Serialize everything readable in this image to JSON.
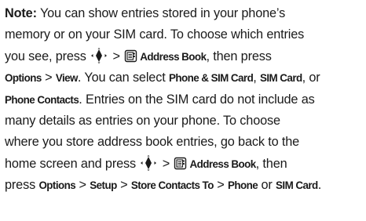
{
  "note": {
    "label": "Note:",
    "line1": " You can show entries stored in your phone’s",
    "line2": "memory or on your SIM card. To choose which entries",
    "line3": "you see, press ",
    "sep": " > ",
    "address_book": "Address Book",
    "then_press": ", then press",
    "options": "Options",
    "view": "View",
    "can_select": ". You can select ",
    "phone_sim_card": "Phone & SIM Card",
    "comma": ", ",
    "sim_card": "SIM Card",
    "or": ", or",
    "phone_contacts": "Phone Contacts",
    "line5_rest": ". Entries on the SIM card do not include as",
    "line6": "many details as entries on your phone. To choose",
    "line7": "where you store address book entries, go back to the",
    "line8_start": "home screen and press ",
    "then_comma": ", then",
    "press": "press ",
    "setup": "Setup",
    "store_contacts_to": "Store Contacts To",
    "phone": "Phone",
    "or_word": " or ",
    "period": "."
  },
  "icons": {
    "nav_key": "navigation-key-icon",
    "address_book": "address-book-icon"
  }
}
